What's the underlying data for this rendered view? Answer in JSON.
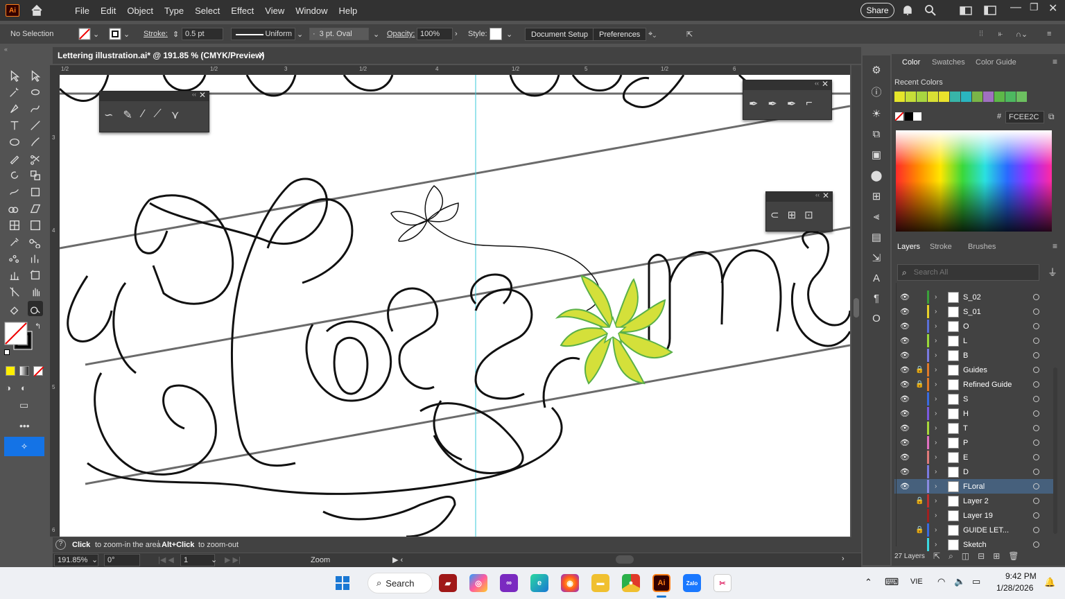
{
  "app": {
    "logo": "Ai",
    "name": "Adobe Illustrator"
  },
  "menu": [
    "File",
    "Edit",
    "Object",
    "Type",
    "Select",
    "Effect",
    "View",
    "Window",
    "Help"
  ],
  "share_label": "Share",
  "control": {
    "selection": "No Selection",
    "stroke_label": "Stroke:",
    "stroke_value": "0.5 pt",
    "profile": "Uniform",
    "brush": "3 pt. Oval",
    "opacity_label": "Opacity:",
    "opacity_value": "100%",
    "style_label": "Style:",
    "doc_setup": "Document Setup",
    "preferences": "Preferences"
  },
  "document": {
    "tab_title": "Lettering illustration.ai* @ 191.85 % (CMYK/Preview)",
    "ruler_top": [
      "1/2",
      "3",
      "1/2",
      "4",
      "1/2",
      "5",
      "1/2",
      "6",
      "1/2"
    ],
    "ruler_left": [
      "3",
      "4",
      "5",
      "6"
    ]
  },
  "status": {
    "hint_bold": "Click",
    "hint": "to zoom-in the area",
    "hint2_bold": "Alt+Click",
    "hint2": "to zoom-out",
    "zoom": "191.85%",
    "angle": "0°",
    "artboard": "1",
    "mode": "Zoom"
  },
  "color_panel": {
    "tabs": [
      "Color",
      "Swatches",
      "Color Guide"
    ],
    "recent_label": "Recent Colors",
    "hex": "FCEE2C",
    "recent": [
      "#e5e52a",
      "#c5de38",
      "#a8d640",
      "#d8e034",
      "#e9e22c",
      "#38b5a8",
      "#2ab5bf",
      "#7ab548",
      "#a070c0",
      "#5db848",
      "#4db860",
      "#6cc060"
    ]
  },
  "layers_panel": {
    "tabs": [
      "Layers",
      "Stroke",
      "Brushes"
    ],
    "search_placeholder": "Search All",
    "count": "27 Layers",
    "layers": [
      {
        "name": "S_02",
        "color": "#3aa03a",
        "locked": false,
        "visible": true,
        "selected": false
      },
      {
        "name": "S_01",
        "color": "#e8d22a",
        "locked": false,
        "visible": true,
        "selected": false
      },
      {
        "name": "O",
        "color": "#5a6fd8",
        "locked": false,
        "visible": true,
        "selected": false
      },
      {
        "name": "L",
        "color": "#9ad83a",
        "locked": false,
        "visible": true,
        "selected": false
      },
      {
        "name": "B",
        "color": "#7a7ae0",
        "locked": false,
        "visible": true,
        "selected": false
      },
      {
        "name": "Guides",
        "color": "#e07a2a",
        "locked": true,
        "visible": true,
        "selected": false
      },
      {
        "name": "Refined Guide",
        "color": "#e07a2a",
        "locked": true,
        "visible": true,
        "selected": false
      },
      {
        "name": "S",
        "color": "#3a6ae0",
        "locked": false,
        "visible": true,
        "selected": false
      },
      {
        "name": "H",
        "color": "#7a5ae0",
        "locked": false,
        "visible": true,
        "selected": false
      },
      {
        "name": "T",
        "color": "#a8d83a",
        "locked": false,
        "visible": true,
        "selected": false
      },
      {
        "name": "P",
        "color": "#e070c0",
        "locked": false,
        "visible": true,
        "selected": false
      },
      {
        "name": "E",
        "color": "#e07a7a",
        "locked": false,
        "visible": true,
        "selected": false
      },
      {
        "name": "D",
        "color": "#7a7ae0",
        "locked": false,
        "visible": true,
        "selected": false
      },
      {
        "name": "FLoral",
        "color": "#8a8ae0",
        "locked": false,
        "visible": true,
        "selected": true
      },
      {
        "name": "Layer 2",
        "color": "#c03030",
        "locked": true,
        "visible": false,
        "selected": false
      },
      {
        "name": "Layer 19",
        "color": "#a02020",
        "locked": false,
        "visible": false,
        "selected": false
      },
      {
        "name": "GUIDE LET...",
        "color": "#3a6ae0",
        "locked": true,
        "visible": false,
        "selected": false
      },
      {
        "name": "Sketch",
        "color": "#3ad8e0",
        "locked": false,
        "visible": false,
        "selected": false
      }
    ]
  },
  "taskbar": {
    "search": "Search",
    "lang": "VIE",
    "time": "9:42 PM",
    "date": "1/28/2026",
    "ai_label": "Ai",
    "zalo_label": "Zalo"
  }
}
